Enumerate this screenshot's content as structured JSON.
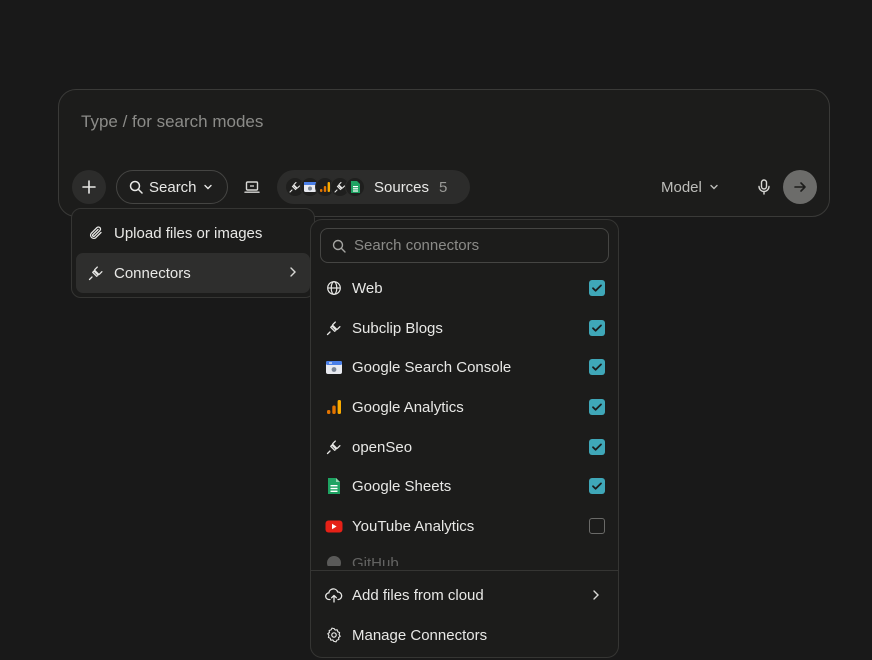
{
  "composer": {
    "placeholder": "Type / for search modes",
    "search_label": "Search",
    "sources_label": "Sources",
    "sources_count": "5",
    "model_label": "Model"
  },
  "attach_menu": {
    "items": [
      {
        "label": "Upload files or images",
        "icon": "paperclip-icon"
      },
      {
        "label": "Connectors",
        "icon": "plug-icon"
      }
    ]
  },
  "connectors_panel": {
    "search_placeholder": "Search connectors",
    "items": [
      {
        "label": "Web",
        "icon": "globe-icon",
        "checked": true
      },
      {
        "label": "Subclip Blogs",
        "icon": "plug-icon",
        "checked": true
      },
      {
        "label": "Google Search Console",
        "icon": "google-search-console-icon",
        "checked": true
      },
      {
        "label": "Google Analytics",
        "icon": "google-analytics-icon",
        "checked": true
      },
      {
        "label": "openSeo",
        "icon": "plug-icon",
        "checked": true
      },
      {
        "label": "Google Sheets",
        "icon": "google-sheets-icon",
        "checked": true
      },
      {
        "label": "YouTube Analytics",
        "icon": "youtube-icon",
        "checked": false
      },
      {
        "label": "GitHub",
        "icon": "github-icon",
        "checked": false
      }
    ],
    "footer": [
      {
        "label": "Add files from cloud",
        "icon": "cloud-upload-icon"
      },
      {
        "label": "Manage Connectors",
        "icon": "gear-icon"
      }
    ]
  },
  "colors": {
    "background": "#191919",
    "checkbox_accent": "#3fa7b8",
    "sheets_green": "#1ea362",
    "analytics_orange": "#f29a0c",
    "youtube_red": "#e62117"
  }
}
